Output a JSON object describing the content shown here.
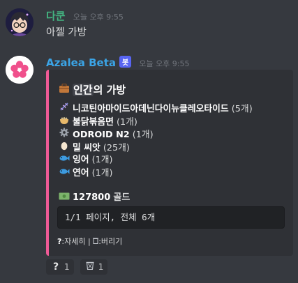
{
  "messages": [
    {
      "author": "다쿤",
      "author_color": "#43b581",
      "timestamp": "오늘 오후 9:55",
      "text": "아젤 가방"
    },
    {
      "author": "Azalea Beta",
      "author_color": "#3ba4e6",
      "bot_tag": "봇",
      "timestamp": "오늘 오후 9:55"
    }
  ],
  "embed": {
    "accent_color": "#ef5a96",
    "title_icon": "briefcase-icon",
    "title_highlight": "인간",
    "title_rest": "의 가방",
    "items": [
      {
        "icon": "dna-icon",
        "name": "니코틴아마이드아데닌다이뉴클레오타이드",
        "count": "(5개)"
      },
      {
        "icon": "noodle-bowl-icon",
        "name": "불닭볶음면",
        "count": "(1개)"
      },
      {
        "icon": "gear-icon",
        "name": "ODROID N2",
        "count": "(1개)"
      },
      {
        "icon": "egg-icon",
        "name": "밀 씨앗",
        "count": "(25개)"
      },
      {
        "icon": "fish-icon",
        "name": "잉어",
        "count": "(1개)"
      },
      {
        "icon": "fish-icon",
        "name": "연어",
        "count": "(1개)"
      }
    ],
    "gold_amount": "127800",
    "gold_label": "골드",
    "page_info": "1/1 페이지, 전체 6개",
    "footer_detail_icon": "?",
    "footer_detail": "자세히",
    "footer_sep": " | ",
    "footer_discard": "버리기"
  },
  "reactions": [
    {
      "icon": "question-icon",
      "glyph": "?",
      "count": "1"
    },
    {
      "icon": "wastebasket-icon",
      "glyph": "",
      "count": "1"
    }
  ]
}
